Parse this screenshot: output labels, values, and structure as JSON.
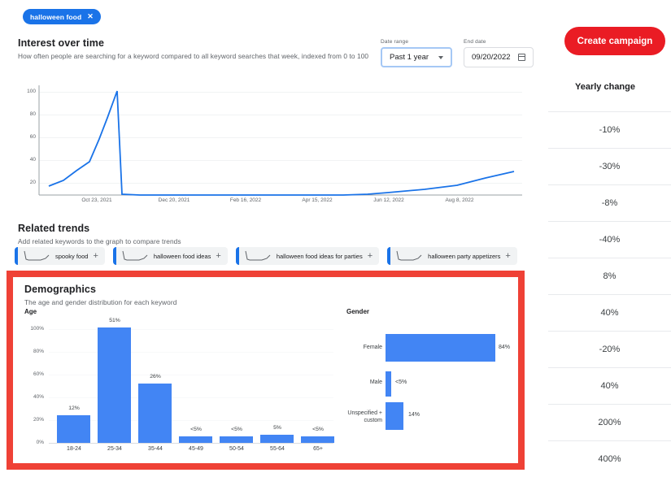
{
  "keyword_chips": [
    {
      "label": "halloween food",
      "close_icon": "close-icon"
    }
  ],
  "interest": {
    "title": "Interest over time",
    "subtitle": "How often people are searching for a keyword compared to all keyword searches that week, indexed from 0 to 100"
  },
  "controls": {
    "date_range_label": "Date range",
    "date_range_value": "Past 1 year",
    "end_date_label": "End date",
    "end_date_value": "09/20/2022",
    "chevron_icon": "chevron-down-icon",
    "calendar_icon": "calendar-icon"
  },
  "related": {
    "title": "Related trends",
    "subtitle": "Add related keywords to the graph to compare trends",
    "chips": [
      {
        "label": "spooky food",
        "add_icon": "plus-icon"
      },
      {
        "label": "halloween food ideas",
        "add_icon": "plus-icon"
      },
      {
        "label": "halloween food ideas for parties",
        "add_icon": "plus-icon"
      },
      {
        "label": "halloween party appetizers",
        "add_icon": "plus-icon"
      }
    ]
  },
  "demographics": {
    "title": "Demographics",
    "subtitle": "The age and gender distribution for each keyword",
    "age_title": "Age",
    "gender_title": "Gender",
    "highlight_color": "#ef4136"
  },
  "right_panel": {
    "create_campaign_label": "Create campaign",
    "create_campaign_color": "#ea1c24",
    "yearly_change_header": "Yearly change",
    "yearly_change_values": [
      "-10%",
      "-30%",
      "-8%",
      "-40%",
      "8%",
      "40%",
      "-20%",
      "40%",
      "200%",
      "400%"
    ]
  },
  "chart_data": [
    {
      "type": "line",
      "title": "Interest over time",
      "xlabel": "",
      "ylabel": "",
      "ylim": [
        0,
        110
      ],
      "yticks": [
        20,
        40,
        60,
        80,
        100
      ],
      "xticks": [
        "Oct 23, 2021",
        "Dec 20, 2021",
        "Feb 16, 2022",
        "Apr 15, 2022",
        "Jun 12, 2022",
        "Aug 8, 2022"
      ],
      "grid": true,
      "legend": "none",
      "line_color": "#1a73e8",
      "series": [
        {
          "name": "halloween food",
          "x": [
            "2021-09-20",
            "2021-10-02",
            "2021-10-09",
            "2021-10-16",
            "2021-10-23",
            "2021-10-30",
            "2021-11-06",
            "2021-12-20",
            "2022-02-16",
            "2022-04-15",
            "2022-05-20",
            "2022-06-12",
            "2022-07-10",
            "2022-08-08",
            "2022-09-05",
            "2022-09-20"
          ],
          "values": [
            18,
            24,
            33,
            41,
            50,
            73,
            101,
            1,
            1,
            1,
            1,
            2,
            3,
            5,
            9,
            14
          ]
        }
      ]
    },
    {
      "type": "bar",
      "title": "Age",
      "categories": [
        "18-24",
        "25-34",
        "35-44",
        "45-49",
        "50-54",
        "55-64",
        "65+"
      ],
      "values": [
        12,
        51,
        26,
        3,
        3,
        5,
        3
      ],
      "value_labels": [
        "12%",
        "51%",
        "26%",
        "<5%",
        "<5%",
        "5%",
        "<5%"
      ],
      "ylabel": "",
      "xlabel": "",
      "ylim": [
        0,
        100
      ],
      "yticks": [
        "0%",
        "20%",
        "40%",
        "60%",
        "80%",
        "100%"
      ],
      "bar_color": "#4285f4",
      "grid": true,
      "legend": "none"
    },
    {
      "type": "bar",
      "orientation": "horizontal",
      "title": "Gender",
      "categories": [
        "Female",
        "Male",
        "Unspecified + custom"
      ],
      "values": [
        84,
        4,
        14
      ],
      "value_labels": [
        "84%",
        "<5%",
        "14%"
      ],
      "xlim": [
        0,
        100
      ],
      "bar_color": "#4285f4",
      "grid": false,
      "legend": "none"
    }
  ]
}
